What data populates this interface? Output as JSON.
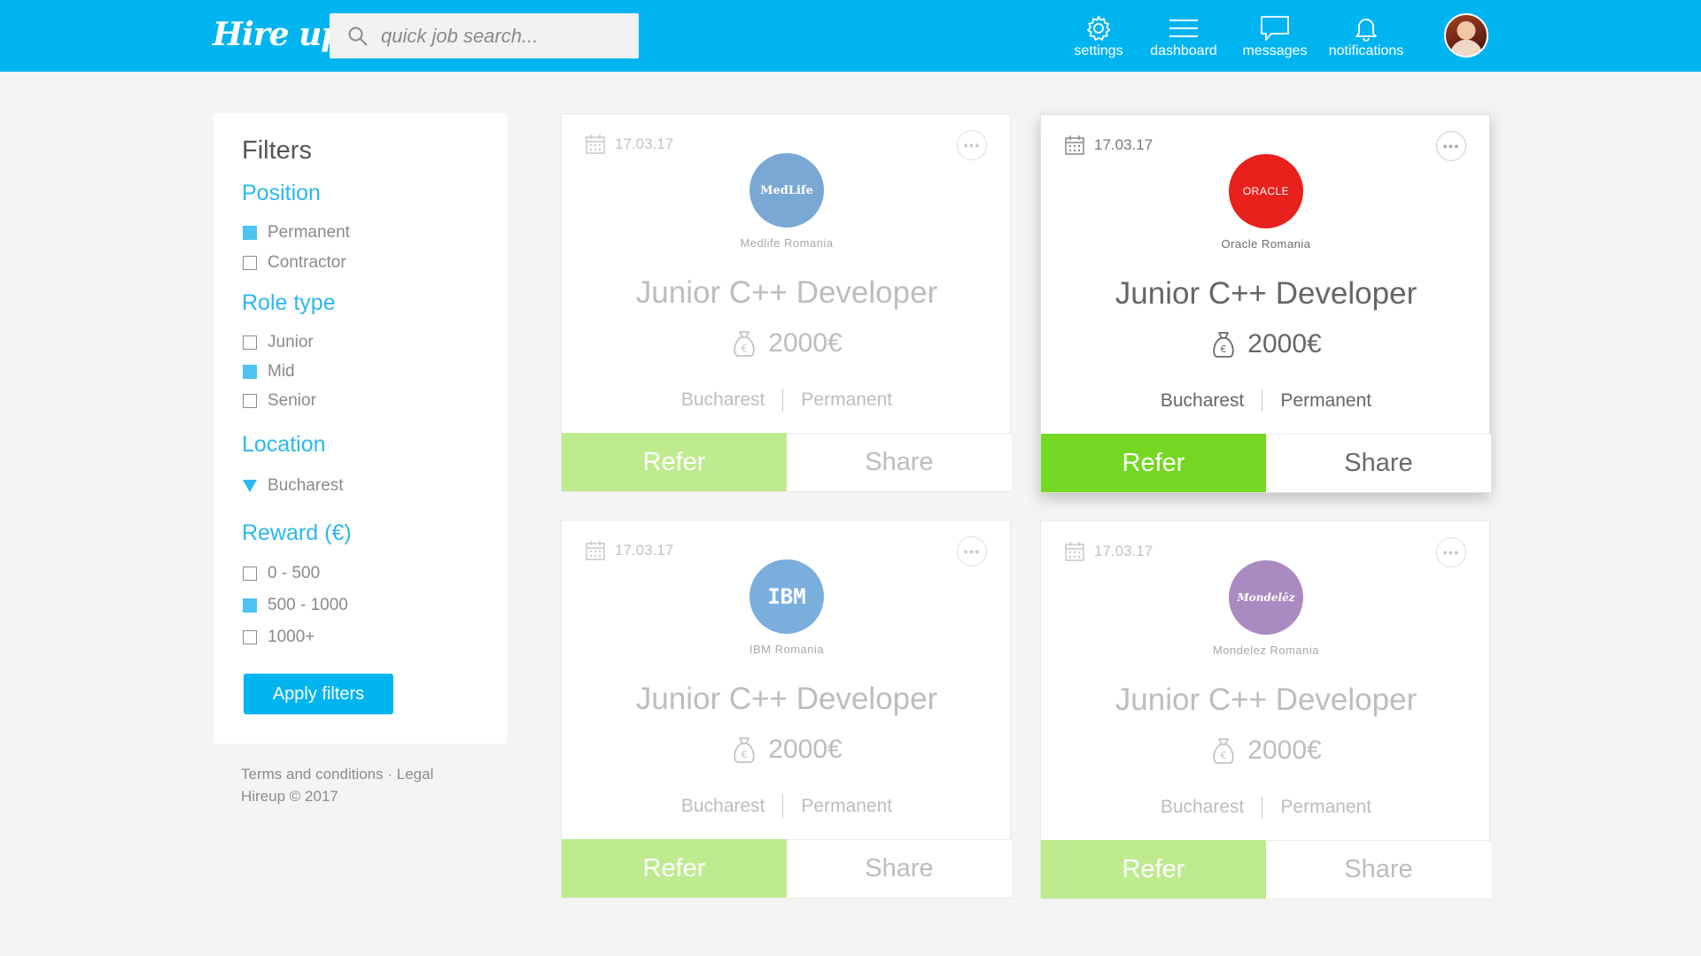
{
  "brand": {
    "logo_text": "Hire up.",
    "primary_color": "#00b4f0"
  },
  "search": {
    "placeholder": "quick job search..."
  },
  "nav": {
    "settings": "settings",
    "dashboard": "dashboard",
    "messages": "messages",
    "notifications": "notifications"
  },
  "filters": {
    "title": "Filters",
    "position": {
      "title": "Position",
      "options": [
        {
          "label": "Permanent",
          "checked": true
        },
        {
          "label": "Contractor",
          "checked": false
        }
      ]
    },
    "role_type": {
      "title": "Role type",
      "options": [
        {
          "label": "Junior",
          "checked": false
        },
        {
          "label": "Mid",
          "checked": true
        },
        {
          "label": "Senior",
          "checked": false
        }
      ]
    },
    "location": {
      "title": "Location",
      "selected": "Bucharest"
    },
    "reward": {
      "title": "Reward (€)",
      "options": [
        {
          "label": "0 - 500",
          "checked": false
        },
        {
          "label": "500 - 1000",
          "checked": true
        },
        {
          "label": "1000+",
          "checked": false
        }
      ]
    },
    "apply_label": "Apply filters"
  },
  "footer": {
    "terms": "Terms and conditions",
    "separator": " · ",
    "legal": "Legal",
    "copyright": "Hireup © 2017"
  },
  "jobs": [
    {
      "date": "17.03.17",
      "company": "Medlife Romania",
      "logo_text": "MedLife",
      "logo_color": "#7aa8d4",
      "role": "Junior C++ Developer",
      "salary": "2000€",
      "location": "Bucharest",
      "type": "Permanent",
      "refer_label": "Refer",
      "share_label": "Share",
      "active": false
    },
    {
      "date": "17.03.17",
      "company": "Oracle Romania",
      "logo_text": "ORACLE",
      "logo_color": "#e8211d",
      "role": "Junior C++ Developer",
      "salary": "2000€",
      "location": "Bucharest",
      "type": "Permanent",
      "refer_label": "Refer",
      "share_label": "Share",
      "active": true
    },
    {
      "date": "17.03.17",
      "company": "IBM Romania",
      "logo_text": "IBM",
      "logo_color": "#79aedd",
      "role": "Junior C++ Developer",
      "salary": "2000€",
      "location": "Bucharest",
      "type": "Permanent",
      "refer_label": "Refer",
      "share_label": "Share",
      "active": false
    },
    {
      "date": "17.03.17",
      "company": "Mondelez Romania",
      "logo_text": "Mondelēz",
      "logo_color": "#a98bc2",
      "role": "Junior C++ Developer",
      "salary": "2000€",
      "location": "Bucharest",
      "type": "Permanent",
      "refer_label": "Refer",
      "share_label": "Share",
      "active": false
    }
  ],
  "colors": {
    "refer_active": "#74d721",
    "refer_inactive": "#bfeb8f",
    "accent_blue": "#2bb8ee"
  }
}
